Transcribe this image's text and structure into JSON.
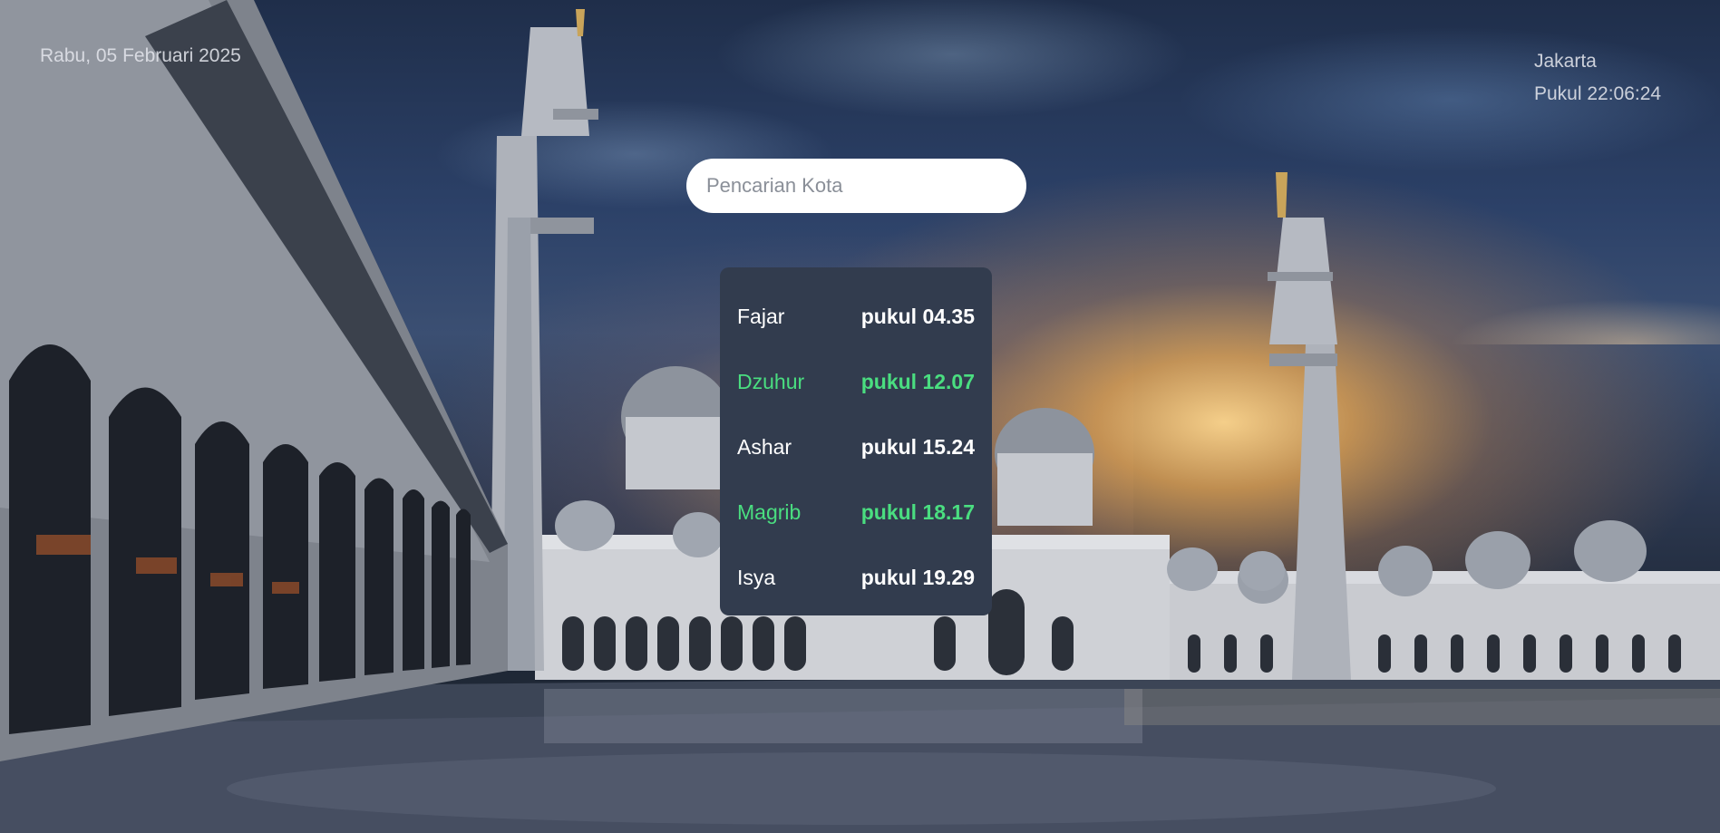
{
  "header": {
    "date": "Rabu, 05 Februari 2025",
    "city": "Jakarta",
    "clock": "Pukul 22:06:24"
  },
  "search": {
    "placeholder": "Pencarian Kota",
    "value": ""
  },
  "prayer_times": [
    {
      "name": "Fajar",
      "time": "pukul 04.35",
      "highlight": false
    },
    {
      "name": "Dzuhur",
      "time": "pukul 12.07",
      "highlight": true
    },
    {
      "name": "Ashar",
      "time": "pukul 15.24",
      "highlight": false
    },
    {
      "name": "Magrib",
      "time": "pukul 18.17",
      "highlight": true
    },
    {
      "name": "Isya",
      "time": "pukul 19.29",
      "highlight": false
    }
  ],
  "colors": {
    "card_bg": "#323c4e",
    "highlight": "#4ade80",
    "text": "#ffffff"
  },
  "background": {
    "icon": "mosque-photo"
  }
}
